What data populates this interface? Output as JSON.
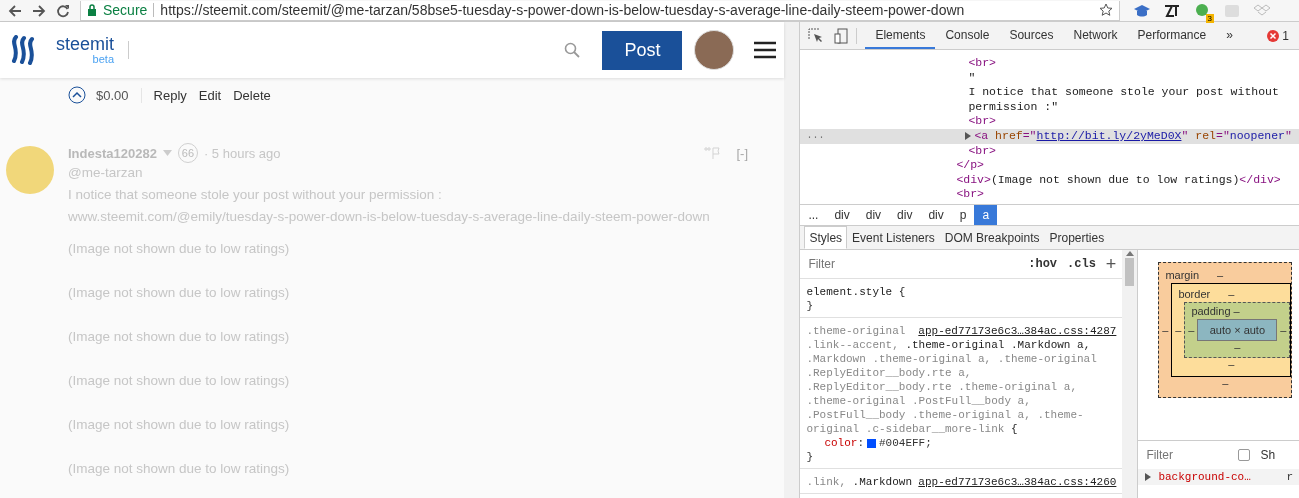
{
  "browser": {
    "security_label": "Secure",
    "url": "https://steemit.com/steemit/@me-tarzan/58bse5-tuesday-s-power-down-is-below-tuesday-s-average-line-daily-steem-power-down",
    "extension_badge": "3"
  },
  "site_header": {
    "logo_text": "steemit",
    "logo_badge": "beta",
    "post_button": "Post"
  },
  "own_comment": {
    "payout": "$0.00",
    "actions": [
      "Reply",
      "Edit",
      "Delete"
    ]
  },
  "comment": {
    "author": "Indesta120282",
    "reputation": "66",
    "time": "· 5 hours ago",
    "collapse": "[-]",
    "lines": [
      "@me-tarzan",
      "I notice that someone stole your post without your permission :",
      "www.steemit.com/@emily/tuesday-s-power-down-is-below-tuesday-s-average-line-daily-steem-power-down"
    ],
    "image_notices": [
      "(Image not shown due to low ratings)",
      "(Image not shown due to low ratings)",
      "(Image not shown due to low ratings)",
      "(Image not shown due to low ratings)",
      "(Image not shown due to low ratings)",
      "(Image not shown due to low ratings)"
    ]
  },
  "devtools": {
    "tabs": [
      {
        "label": "Elements",
        "selected": true
      },
      {
        "label": "Console",
        "selected": false
      },
      {
        "label": "Sources",
        "selected": false
      },
      {
        "label": "Network",
        "selected": false
      },
      {
        "label": "Performance",
        "selected": false
      }
    ],
    "more_tabs": "»",
    "error_count": "1",
    "dom_tree": [
      {
        "children": [
          {
            "kind": "leaf",
            "selected": false,
            "parts": [
              {
                "text": "<br>",
                "kind": "tag"
              }
            ]
          },
          {
            "kind": "leaf",
            "selected": false,
            "parts": [
              {
                "text": "\"",
                "kind": "text"
              }
            ]
          },
          {
            "kind": "leaf",
            "selected": false,
            "parts": [
              {
                "text": "I notice that someone stole your post without",
                "kind": "text"
              }
            ]
          },
          {
            "kind": "leaf",
            "selected": false,
            "parts": [
              {
                "text": "permission :\"",
                "kind": "text"
              }
            ]
          },
          {
            "kind": "leaf",
            "selected": false,
            "parts": [
              {
                "text": "<br>",
                "kind": "tag"
              }
            ]
          },
          {
            "kind": "collapsed",
            "selected": true,
            "parts": [
              {
                "text": "<a ",
                "kind": "tag"
              },
              {
                "text": "href",
                "kind": "attr"
              },
              {
                "text": "=\"",
                "kind": "tag"
              },
              {
                "text": "http://bit.ly/2yMeD0X",
                "kind": "url"
              },
              {
                "text": "\" ",
                "kind": "tag"
              },
              {
                "text": "rel",
                "kind": "attr"
              },
              {
                "text": "=\"",
                "kind": "tag"
              },
              {
                "text": "noopener",
                "kind": "value"
              },
              {
                "text": "\"",
                "kind": "tag"
              }
            ]
          },
          {
            "kind": "leaf",
            "selected": false,
            "parts": [
              {
                "text": "<br>",
                "kind": "tag"
              }
            ]
          }
        ]
      },
      {
        "kind": "leaf",
        "selected": false,
        "parts": [
          {
            "text": "</p>",
            "kind": "tag"
          }
        ]
      },
      {
        "kind": "leaf",
        "selected": false,
        "parts": [
          {
            "text": "<div>",
            "kind": "tag"
          },
          {
            "text": "(Image not shown due to low ratings)",
            "kind": "text"
          },
          {
            "text": "</div>",
            "kind": "tag"
          }
        ]
      },
      {
        "kind": "leaf",
        "selected": false,
        "parts": [
          {
            "text": "<br>",
            "kind": "tag"
          }
        ]
      }
    ],
    "selected_row_marker": "...",
    "breadcrumbs": [
      {
        "label": "...",
        "selected": false
      },
      {
        "label": "div",
        "selected": false
      },
      {
        "label": "div",
        "selected": false
      },
      {
        "label": "div",
        "selected": false
      },
      {
        "label": "div",
        "selected": false
      },
      {
        "label": "p",
        "selected": false
      },
      {
        "label": "a",
        "selected": true
      }
    ],
    "sub_tabs": [
      {
        "label": "Styles",
        "selected": true
      },
      {
        "label": "Event Listeners",
        "selected": false
      },
      {
        "label": "DOM Breakpoints",
        "selected": false
      },
      {
        "label": "Properties",
        "selected": false
      }
    ],
    "styles": {
      "filter_placeholder": "Filter",
      "toggles": [
        ":hov",
        ".cls"
      ],
      "add": "+",
      "rules": [
        {
          "selector_lines": [
            [
              {
                "text": "element.style {",
                "matched": true
              }
            ]
          ],
          "close": "}"
        },
        {
          "source": "app-ed77173e6c3…384ac.css:4287",
          "selector_lines": [
            [
              {
                "text": ".theme-original",
                "matched": false
              }
            ],
            [
              {
                "text": ".link--accent, ",
                "matched": false
              },
              {
                "text": ".theme-original .Markdown a,",
                "matched": true
              }
            ],
            [
              {
                "text": ".Markdown .theme-original a, .theme-original",
                "matched": false
              }
            ],
            [
              {
                "text": ".ReplyEditor__body.rte a,",
                "matched": false
              }
            ],
            [
              {
                "text": ".ReplyEditor__body.rte .theme-original a,",
                "matched": false
              }
            ],
            [
              {
                "text": ".theme-original .PostFull__body a,",
                "matched": false
              }
            ],
            [
              {
                "text": ".PostFull__body .theme-original a, .theme-",
                "matched": false
              }
            ],
            [
              {
                "text": "original .c-sidebar__more-link ",
                "matched": false
              },
              {
                "text": "{",
                "matched": true
              }
            ]
          ],
          "declarations": [
            {
              "name": "color",
              "separator": ":",
              "value": "#004EFF;",
              "color": "#004eff"
            }
          ],
          "close": "}"
        },
        {
          "source": "app-ed77173e6c3…384ac.css:4260",
          "selector_lines": [
            [
              {
                "text": ".link, ",
                "matched": false
              },
              {
                "text": ".Markdown",
                "matched": true
              }
            ]
          ]
        }
      ]
    },
    "box_model": {
      "margin": {
        "label": "margin",
        "top": "–",
        "bottom": "–",
        "left": "–"
      },
      "border": {
        "label": "border",
        "top": "–",
        "bottom": "–",
        "left": "–"
      },
      "padding": {
        "label": "padding",
        "top": "–",
        "bottom": "–",
        "left": "–",
        "right": "–"
      },
      "content": "auto × auto"
    },
    "computed": {
      "filter_placeholder": "Filter",
      "show_all_label": "Sh",
      "show_all_checked": false,
      "properties": [
        {
          "name": "background-co…",
          "value": "r"
        }
      ]
    }
  }
}
